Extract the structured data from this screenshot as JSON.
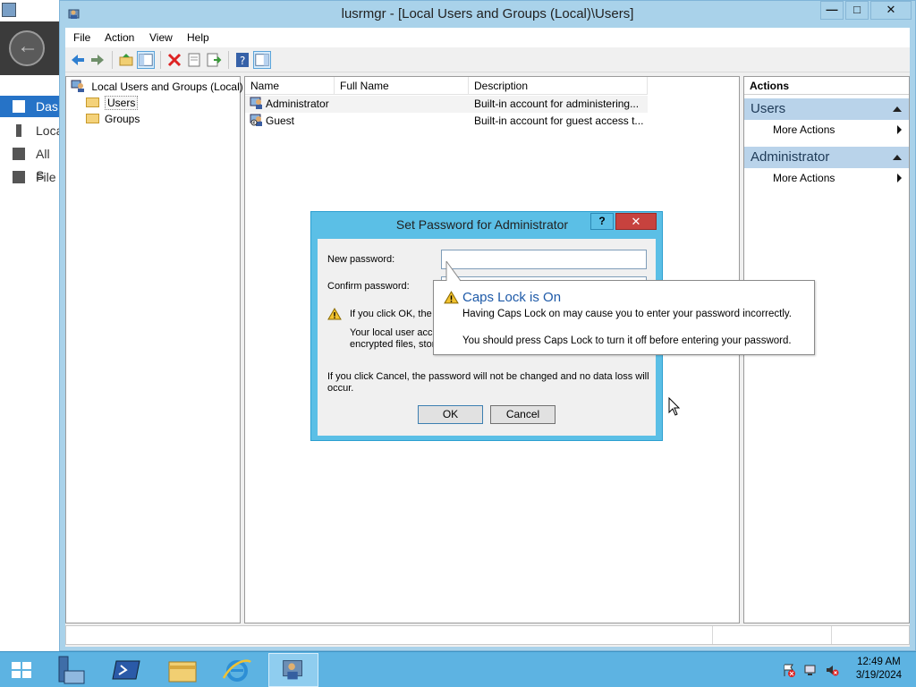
{
  "background_app": {
    "nav_items": [
      "Das",
      "Loca",
      "All S",
      "File"
    ]
  },
  "window": {
    "title": "lusrmgr - [Local Users and Groups (Local)\\Users]",
    "controls": {
      "minimize": "—",
      "maximize": "□",
      "close": "✕"
    }
  },
  "menu": [
    "File",
    "Action",
    "View",
    "Help"
  ],
  "toolbar_icons": [
    "back-icon",
    "forward-icon",
    "up-folder-icon",
    "show-hide-tree-icon",
    "delete-icon",
    "properties-icon",
    "export-list-icon",
    "help-icon",
    "show-hide-action-pane-icon"
  ],
  "tree": {
    "root": "Local Users and Groups (Local)",
    "children": [
      "Users",
      "Groups"
    ],
    "selected": "Users"
  },
  "list": {
    "columns": [
      "Name",
      "Full Name",
      "Description"
    ],
    "rows": [
      {
        "name": "Administrator",
        "full_name": "",
        "description": "Built-in account for administering..."
      },
      {
        "name": "Guest",
        "full_name": "",
        "description": "Built-in account for guest access t..."
      }
    ]
  },
  "actions": {
    "header": "Actions",
    "sections": [
      {
        "title": "Users",
        "items": [
          "More Actions"
        ]
      },
      {
        "title": "Administrator",
        "items": [
          "More Actions"
        ]
      }
    ]
  },
  "dialog": {
    "title": "Set Password for Administrator",
    "help": "?",
    "close": "✕",
    "new_password_label": "New password:",
    "new_password_value": "",
    "confirm_password_label": "Confirm password:",
    "confirm_password_value": "",
    "warning_line1": "If you click OK, the f",
    "warning_line2": "Your local user acco",
    "warning_line3": "encrypted files, store",
    "cancel_note_line1": "If you click Cancel, the password will not be changed and no data loss will",
    "cancel_note_line2": "occur.",
    "ok": "OK",
    "cancel": "Cancel"
  },
  "balloon": {
    "title": "Caps Lock is On",
    "line1": "Having Caps Lock on may cause you to enter your password incorrectly.",
    "line2": "You should press Caps Lock to turn it off before entering your password."
  },
  "taskbar": {
    "items": [
      "start-icon",
      "server-manager-icon",
      "powershell-icon",
      "file-explorer-icon",
      "internet-explorer-icon",
      "lusrmgr-icon"
    ],
    "time": "12:49 AM",
    "date": "3/19/2024"
  },
  "colors": {
    "window_frame": "#a9d2ea",
    "dialog_frame": "#5bbfe6",
    "taskbar": "#5db3e2",
    "close_red": "#c7423e",
    "balloon_title": "#1e5aa8",
    "action_section": "#b9d3ea"
  }
}
